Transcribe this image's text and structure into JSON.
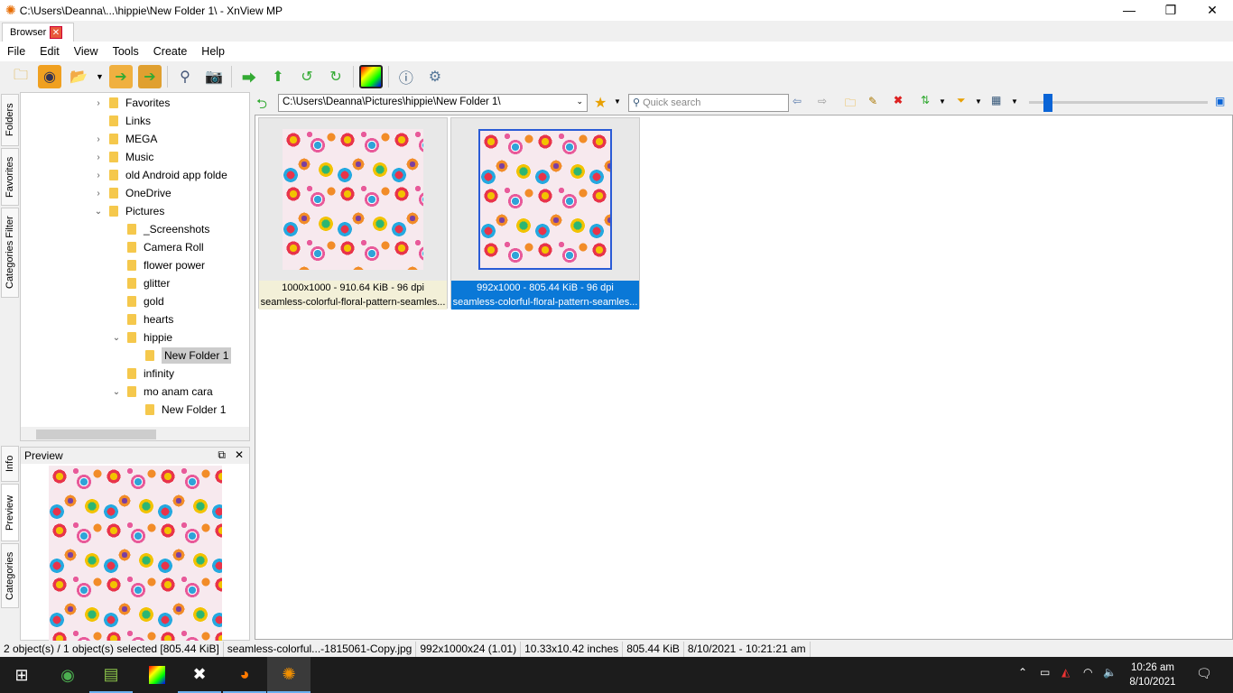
{
  "window": {
    "title": "C:\\Users\\Deanna\\...\\hippie\\New Folder 1\\ - XnView MP",
    "minimize": "—",
    "maximize": "❐",
    "close": "✕"
  },
  "tab": {
    "label": "Browser",
    "close": "✕"
  },
  "menu": [
    "File",
    "Edit",
    "View",
    "Tools",
    "Create",
    "Help"
  ],
  "side_tabs": {
    "folders": "Folders",
    "favorites": "Favorites",
    "categories_filter": "Categories Filter",
    "info": "Info",
    "preview": "Preview",
    "categories": "Categories"
  },
  "tree": [
    {
      "label": "Favorites",
      "level": 1,
      "exp": ">"
    },
    {
      "label": "Links",
      "level": 1,
      "exp": ""
    },
    {
      "label": "MEGA",
      "level": 1,
      "exp": ">"
    },
    {
      "label": "Music",
      "level": 1,
      "exp": ">"
    },
    {
      "label": "old Android app folde",
      "level": 1,
      "exp": ">"
    },
    {
      "label": "OneDrive",
      "level": 1,
      "exp": ">"
    },
    {
      "label": "Pictures",
      "level": 1,
      "exp": "v"
    },
    {
      "label": "_Screenshots",
      "level": 2,
      "exp": ""
    },
    {
      "label": "Camera Roll",
      "level": 2,
      "exp": ""
    },
    {
      "label": "flower power",
      "level": 2,
      "exp": ""
    },
    {
      "label": "glitter",
      "level": 2,
      "exp": ""
    },
    {
      "label": "gold",
      "level": 2,
      "exp": ""
    },
    {
      "label": "hearts",
      "level": 2,
      "exp": ""
    },
    {
      "label": "hippie",
      "level": 2,
      "exp": "v"
    },
    {
      "label": "New Folder 1",
      "level": 3,
      "exp": "",
      "selected": true
    },
    {
      "label": "infinity",
      "level": 2,
      "exp": ""
    },
    {
      "label": "mo anam cara",
      "level": 2,
      "exp": "v"
    },
    {
      "label": "New Folder 1",
      "level": 3,
      "exp": ""
    }
  ],
  "preview": {
    "title": "Preview"
  },
  "address": {
    "path": "C:\\Users\\Deanna\\Pictures\\hippie\\New Folder 1\\",
    "search_placeholder": "Quick search"
  },
  "thumbs": [
    {
      "info": "1000x1000 - 910.64 KiB - 96 dpi",
      "name": "seamless-colorful-floral-pattern-seamles...",
      "selected": false
    },
    {
      "info": "992x1000 - 805.44 KiB - 96 dpi",
      "name": "seamless-colorful-floral-pattern-seamles...",
      "selected": true
    }
  ],
  "status": [
    "2 object(s) / 1 object(s) selected [805.44 KiB]",
    "seamless-colorful...-1815061-Copy.jpg",
    "992x1000x24 (1.01)",
    "10.33x10.42 inches",
    "805.44 KiB",
    "8/10/2021 - 10:21:21 am"
  ],
  "taskbar": {
    "time": "10:26 am",
    "date": "8/10/2021"
  }
}
